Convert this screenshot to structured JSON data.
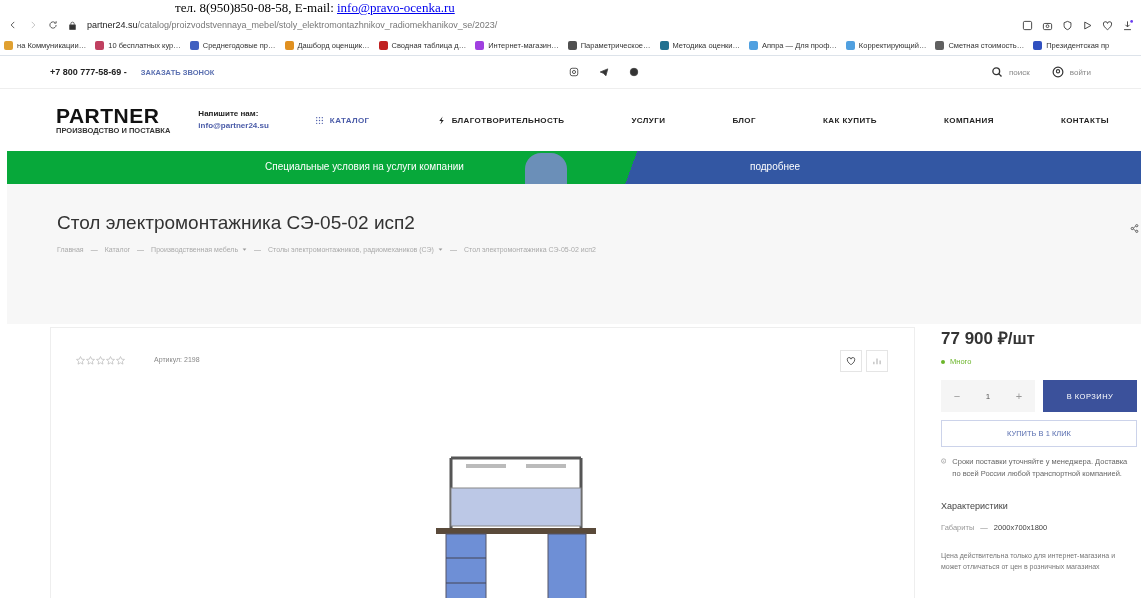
{
  "overlay_text": {
    "text": "тел. 8(950)850-08-58, E-mail:",
    "link": "info@pravo-ocenka.ru"
  },
  "browser": {
    "url_host": "partner24.su",
    "url_path": "/catalog/proizvodstvennaya_mebel/stoly_elektromontazhnikov_radiomekhanikov_se/2023/",
    "bookmarks": [
      {
        "label": "на Коммуникации…",
        "color": "#e0a030"
      },
      {
        "label": "10 бесплатных кур…",
        "color": "#c04060"
      },
      {
        "label": "Среднегодовые пр…",
        "color": "#4060c0"
      },
      {
        "label": "Дашборд оценщик…",
        "color": "#e09020"
      },
      {
        "label": "Сводная таблица д…",
        "color": "#c02020"
      },
      {
        "label": "Интернет-магазин…",
        "color": "#a040e0"
      },
      {
        "label": "Параметрическое…",
        "color": "#505050"
      },
      {
        "label": "Методика оценки…",
        "color": "#207090"
      },
      {
        "label": "Аппра — Для проф…",
        "color": "#50a0e0"
      },
      {
        "label": "Корректирующий…",
        "color": "#50a0e0"
      },
      {
        "label": "Сметная стоимость…",
        "color": "#606060"
      },
      {
        "label": "Президентская пр",
        "color": "#3050c0"
      }
    ]
  },
  "topbar": {
    "phone": "+7 800 777-58-69 -",
    "callback": "ЗАКАЗАТЬ ЗВОНОК",
    "search": "поиск",
    "login": "войти"
  },
  "header": {
    "logo": "PARTNER",
    "logo_sub": "ПРОИЗВОДСТВО И ПОСТАВКА",
    "write_label": "Напишите нам:",
    "email": "info@partner24.su",
    "nav": [
      {
        "label": "КАТАЛОГ",
        "kind": "catalog"
      },
      {
        "label": "БЛАГОТВОРИТЕЛЬНОСТЬ",
        "kind": "charity"
      },
      {
        "label": "УСЛУГИ",
        "kind": "plain"
      },
      {
        "label": "БЛОГ",
        "kind": "plain"
      },
      {
        "label": "КАК КУПИТЬ",
        "kind": "plain"
      },
      {
        "label": "КОМПАНИЯ",
        "kind": "plain"
      },
      {
        "label": "КОНТАКТЫ",
        "kind": "plain"
      }
    ]
  },
  "banner": {
    "text": "Специальные условия на услуги компании",
    "more": "подробнее"
  },
  "title": "Стол электромонтажника СЭ-05-02 исп2",
  "breadcrumb_separator": "—",
  "breadcrumbs": [
    {
      "label": "Главная",
      "dropdown": false
    },
    {
      "label": "Каталог",
      "dropdown": false
    },
    {
      "label": "Производственная мебель",
      "dropdown": true
    },
    {
      "label": "Столы электромонтажников, радиомехаников (СЭ)",
      "dropdown": true
    },
    {
      "label": "Стол электромонтажника СЭ-05-02 исп2",
      "dropdown": false
    }
  ],
  "product": {
    "stars": 0,
    "article": "Артикул: 2198",
    "price": "77 900 ₽/шт",
    "stock": "Много",
    "quantity": "1",
    "minus": "−",
    "plus": "+",
    "cart": "В КОРЗИНУ",
    "one_click": "КУПИТЬ В 1 КЛИК",
    "delivery": "Сроки поставки уточняйте у менеджера. Доставка по всей России любой транспортной компанией.",
    "specs_title": "Характеристики",
    "specs": [
      {
        "name": "Габариты",
        "separator": "—",
        "value": "2000x700x1800"
      }
    ],
    "note": "Цена действительна только для интернет-магазина и может отличаться от цен в розничных магазинах"
  }
}
